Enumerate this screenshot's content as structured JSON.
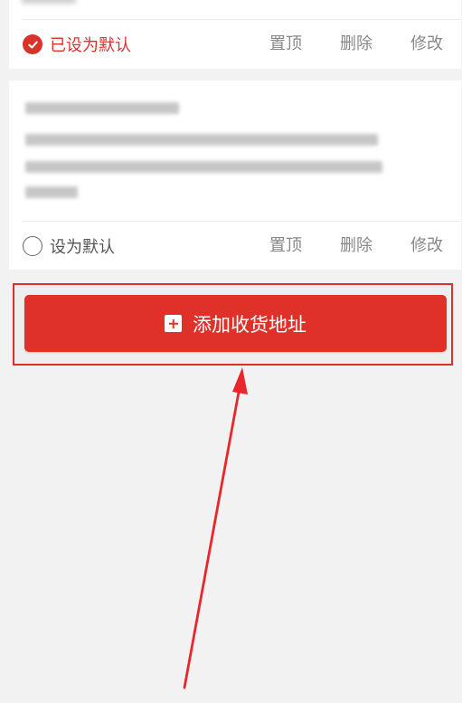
{
  "addresses": [
    {
      "default_label": "已设为默认",
      "is_default": true,
      "actions": {
        "pin": "置顶",
        "delete": "删除",
        "edit": "修改"
      }
    },
    {
      "contact": "郑楠,13995508973",
      "address": "湖北省 武汉市 江夏区 江夏区经济开发区大桥新区街道经济开发区大桥新区办事处金橡树一家家区",
      "default_label": "设为默认",
      "is_default": false,
      "actions": {
        "pin": "置顶",
        "delete": "删除",
        "edit": "修改"
      }
    }
  ],
  "add_button": {
    "label": "添加收货地址"
  },
  "colors": {
    "accent": "#e0302a",
    "annotation": "#e8262b",
    "background": "#f2f2f2"
  },
  "icons": {
    "default_checked": "check-circle-icon",
    "default_unchecked": "empty-circle-icon",
    "add": "plus-square-icon"
  }
}
